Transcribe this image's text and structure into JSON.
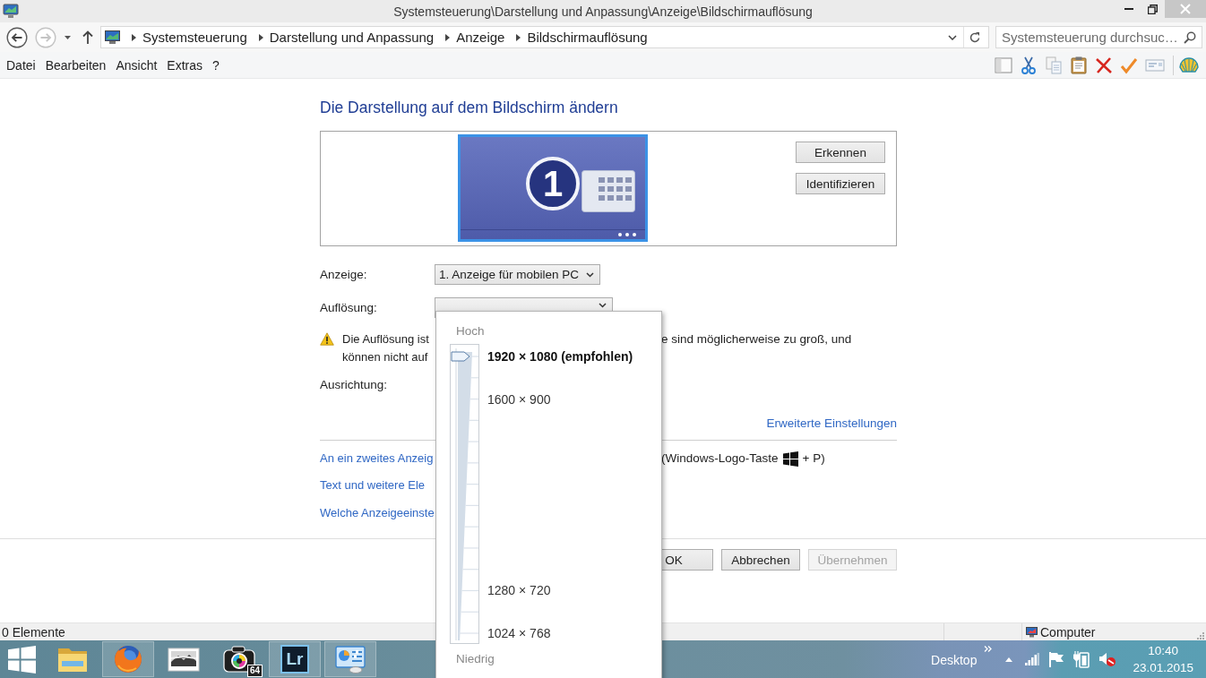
{
  "window": {
    "title": "Systemsteuerung\\Darstellung und Anpassung\\Anzeige\\Bildschirmauflösung"
  },
  "navigation": {
    "buttons": [
      {
        "kind": "back",
        "disabled": false
      },
      {
        "kind": "forward",
        "disabled": true
      }
    ],
    "breadcrumbs": [
      "Systemsteuerung",
      "Darstellung und Anpassung",
      "Anzeige",
      "Bildschirmauflösung"
    ],
    "search": {
      "placeholder": "Systemsteuerung durchsuc…"
    }
  },
  "menu": [
    "Datei",
    "Bearbeiten",
    "Ansicht",
    "Extras",
    "?"
  ],
  "page": {
    "heading": "Die Darstellung auf dem Bildschirm ändern",
    "monitor": {
      "number": "1"
    },
    "detect_buttons": [
      "Erkennen",
      "Identifizieren"
    ],
    "display_setting": {
      "label": "Anzeige:",
      "value": "1. Anzeige für mobilen PC"
    },
    "resolution_setting": {
      "label": "Auflösung:"
    },
    "warning": {
      "left_lines": [
        "Die Auflösung ist",
        "können nicht auf"
      ],
      "right_text": "e sind möglicherweise zu groß, und"
    },
    "orientation_setting": {
      "label": "Ausrichtung:"
    },
    "advanced_link": "Erweiterte Einstellungen",
    "links": [
      {
        "text": "An ein zweites Anzeig",
        "shortcut_before": "(Windows-Logo-Taste",
        "shortcut_after": "+ P)"
      },
      {
        "text": "Text und weitere Ele"
      },
      {
        "text": "Welche Anzeigeeinste"
      }
    ]
  },
  "dialog_buttons": [
    {
      "label": "OK",
      "disabled": false
    },
    {
      "label": "Abbrechen",
      "disabled": false
    },
    {
      "label": "Übernehmen",
      "disabled": true
    }
  ],
  "resolution_popup": {
    "top_label": "Hoch",
    "bottom_label": "Niedrig",
    "level": 1,
    "options": [
      {
        "label": "1920 × 1080 (empfohlen)",
        "selected": true
      },
      {
        "label": "1600 × 900",
        "selected": false
      },
      {
        "label": "1280 × 720",
        "selected": false
      },
      {
        "label": "1024 × 768",
        "selected": false
      }
    ]
  },
  "status_bar": {
    "count": "0 Elemente",
    "location": "Computer"
  },
  "taskbar": {
    "apps": [
      {
        "kind": "folder",
        "running": false
      },
      {
        "kind": "browser",
        "running": true
      },
      {
        "kind": "photos",
        "running": false
      },
      {
        "kind": "camera",
        "running": false,
        "badge": "64"
      },
      {
        "kind": "tile",
        "running": true,
        "label": "Lr"
      },
      {
        "kind": "control_panel",
        "running": true
      }
    ],
    "toolbar_label": "Desktop",
    "muted": true,
    "time": "10:40",
    "date": "23.01.2015"
  }
}
